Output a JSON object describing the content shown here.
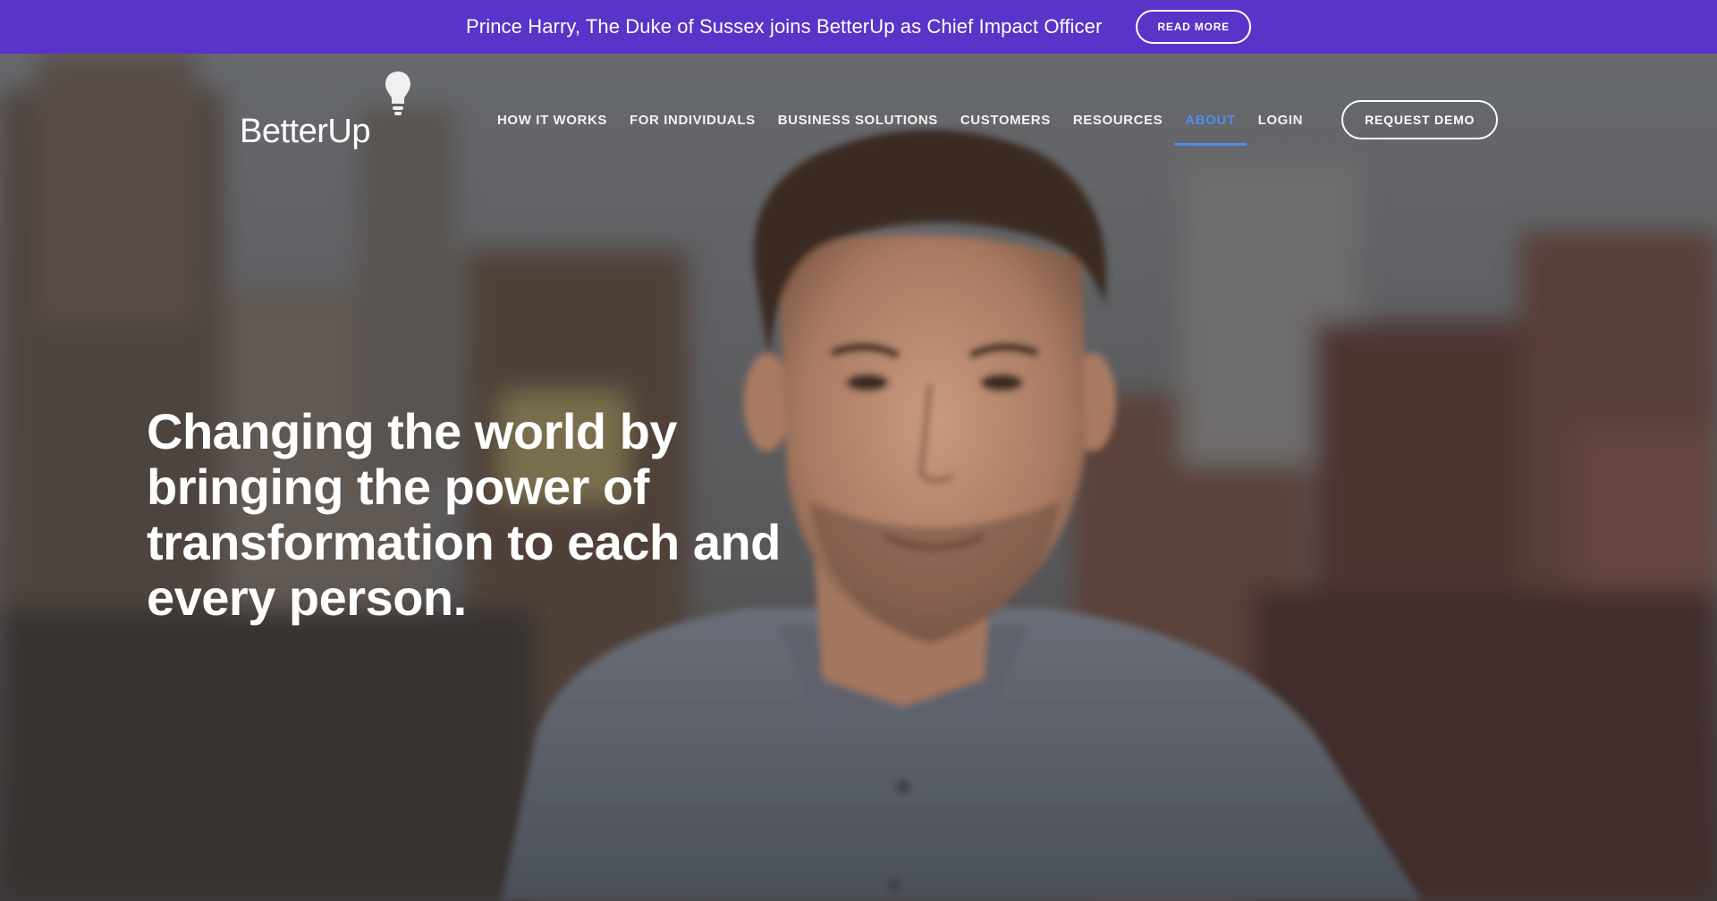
{
  "announcement": {
    "text": "Prince Harry, The Duke of Sussex joins BetterUp as Chief Impact Officer",
    "button_label": "READ MORE"
  },
  "logo": {
    "text": "BetterUp"
  },
  "nav": {
    "items": [
      {
        "label": "HOW IT WORKS"
      },
      {
        "label": "FOR INDIVIDUALS"
      },
      {
        "label": "BUSINESS SOLUTIONS"
      },
      {
        "label": "CUSTOMERS"
      },
      {
        "label": "RESOURCES"
      },
      {
        "label": "ABOUT",
        "active": true
      },
      {
        "label": "LOGIN"
      }
    ],
    "cta_label": "REQUEST DEMO"
  },
  "hero": {
    "headline_lines": [
      "Changing the world by",
      "bringing the power of",
      "transformation to each and",
      "every person."
    ]
  },
  "colors": {
    "announcement_bg": "#5a33c8",
    "active_nav": "#4d8df0",
    "text": "#ffffff"
  }
}
